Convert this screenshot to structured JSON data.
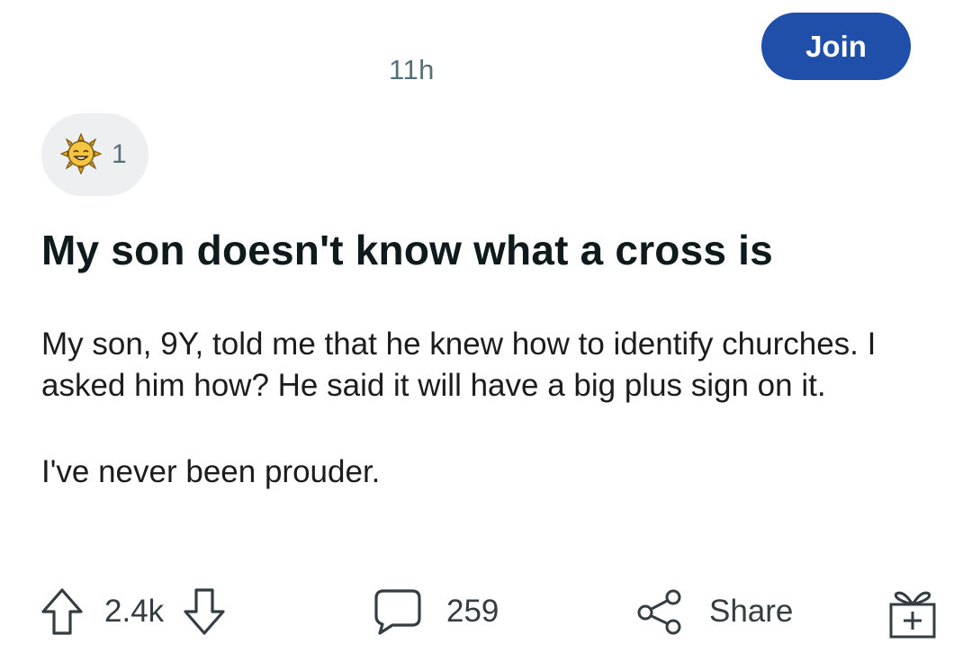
{
  "post": {
    "timestamp": "11h",
    "join_label": "Join",
    "award_count": "1",
    "title": "My son doesn't know what a cross is",
    "body_paragraphs": [
      "My son, 9Y, told me that he knew how to identify churches. I asked him how? He said it will have a big plus sign on it.",
      "I've never been prouder."
    ]
  },
  "actions": {
    "vote_count": "2.4k",
    "comment_count": "259",
    "share_label": "Share"
  },
  "icons": {
    "award": "sun-award-icon",
    "upvote": "arrow-up-icon",
    "downvote": "arrow-down-icon",
    "comment": "comment-bubble-icon",
    "share": "share-icon",
    "gift": "gift-icon"
  },
  "colors": {
    "join_button": "#1f4fa8",
    "award_pill": "#edeff1",
    "secondary_text": "#576f76",
    "award_gold": "#f5c542"
  }
}
